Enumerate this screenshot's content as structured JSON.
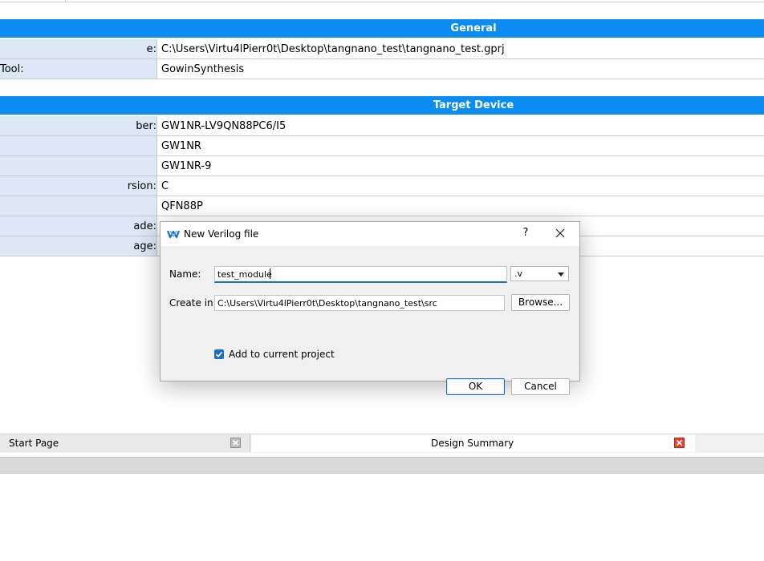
{
  "general": {
    "header": "General",
    "rows": [
      {
        "label": "e:",
        "value": "C:\\Users\\Virtu4lPierr0t\\Desktop\\tangnano_test\\tangnano_test.gprj"
      },
      {
        "label": " Tool:",
        "value": "GowinSynthesis"
      }
    ]
  },
  "target_device": {
    "header": "Target Device",
    "rows": [
      {
        "label": "ber:",
        "value": "GW1NR-LV9QN88PC6/I5"
      },
      {
        "label": "",
        "value": "GW1NR"
      },
      {
        "label": "",
        "value": "GW1NR-9"
      },
      {
        "label": "rsion:",
        "value": "C"
      },
      {
        "label": "",
        "value": "QFN88P"
      },
      {
        "label": "ade:",
        "value": ""
      },
      {
        "label": "age:",
        "value": ""
      }
    ]
  },
  "dialog": {
    "title": "New Verilog file",
    "help_label": "?",
    "name_label": "Name:",
    "name_value": "test_module",
    "extension_value": ".v",
    "create_in_label": "Create in:",
    "create_in_value": "C:\\Users\\Virtu4lPierr0t\\Desktop\\tangnano_test\\src",
    "browse_label": "Browse...",
    "add_to_project_label": "Add to current project",
    "add_to_project_checked": true,
    "ok_label": "OK",
    "cancel_label": "Cancel"
  },
  "tabs": [
    {
      "label": "Start Page",
      "active": false
    },
    {
      "label": "Design Summary",
      "active": true
    }
  ],
  "colors": {
    "section_header": "#0a8cf0",
    "label_cell": "#dce8f5",
    "accent": "#1a6fc4",
    "tab_close_active": "#e8412c"
  },
  "icons": {
    "dialog_logo": "gowin-logo-icon",
    "dialog_close": "close-icon",
    "dropdown": "chevron-down-icon",
    "checkbox": "checkmark-icon",
    "tab_close": "tab-close-icon"
  }
}
